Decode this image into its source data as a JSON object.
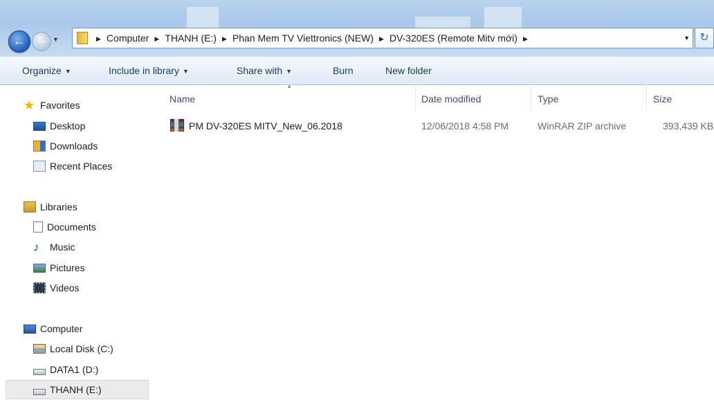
{
  "breadcrumbs": [
    "Computer",
    "THANH (E:)",
    "Phan Mem TV Viettronics (NEW)",
    "DV-320ES (Remote Mitv mới)"
  ],
  "toolbar": {
    "organize": "Organize",
    "include_in_library": "Include in library",
    "share_with": "Share with",
    "burn": "Burn",
    "new_folder": "New folder"
  },
  "nav": {
    "favorites": {
      "label": "Favorites",
      "items": [
        "Desktop",
        "Downloads",
        "Recent Places"
      ]
    },
    "libraries": {
      "label": "Libraries",
      "items": [
        "Documents",
        "Music",
        "Pictures",
        "Videos"
      ]
    },
    "computer": {
      "label": "Computer",
      "items": [
        "Local Disk (C:)",
        "DATA1 (D:)",
        "THANH (E:)"
      ],
      "selected": "THANH (E:)"
    }
  },
  "columns": {
    "name": "Name",
    "date_modified": "Date modified",
    "type": "Type",
    "size": "Size"
  },
  "files": [
    {
      "name": "PM DV-320ES MITV_New_06.2018",
      "date_modified": "12/06/2018 4:58 PM",
      "type": "WinRAR ZIP archive",
      "size": "393,439 KB",
      "icon": "winrar-archive-icon"
    }
  ],
  "icons": {
    "back": "back-arrow-icon",
    "forward": "forward-arrow-icon",
    "folder": "folder-icon",
    "refresh": "refresh-icon",
    "favorites": "star-icon",
    "libraries": "libraries-icon",
    "computer": "computer-icon",
    "drive": "drive-icon"
  },
  "colors": {
    "address_bar": "#a9c8ea",
    "command_bar": "#dde9f7",
    "command_text": "#1e3b63",
    "selection": "#ececec"
  }
}
